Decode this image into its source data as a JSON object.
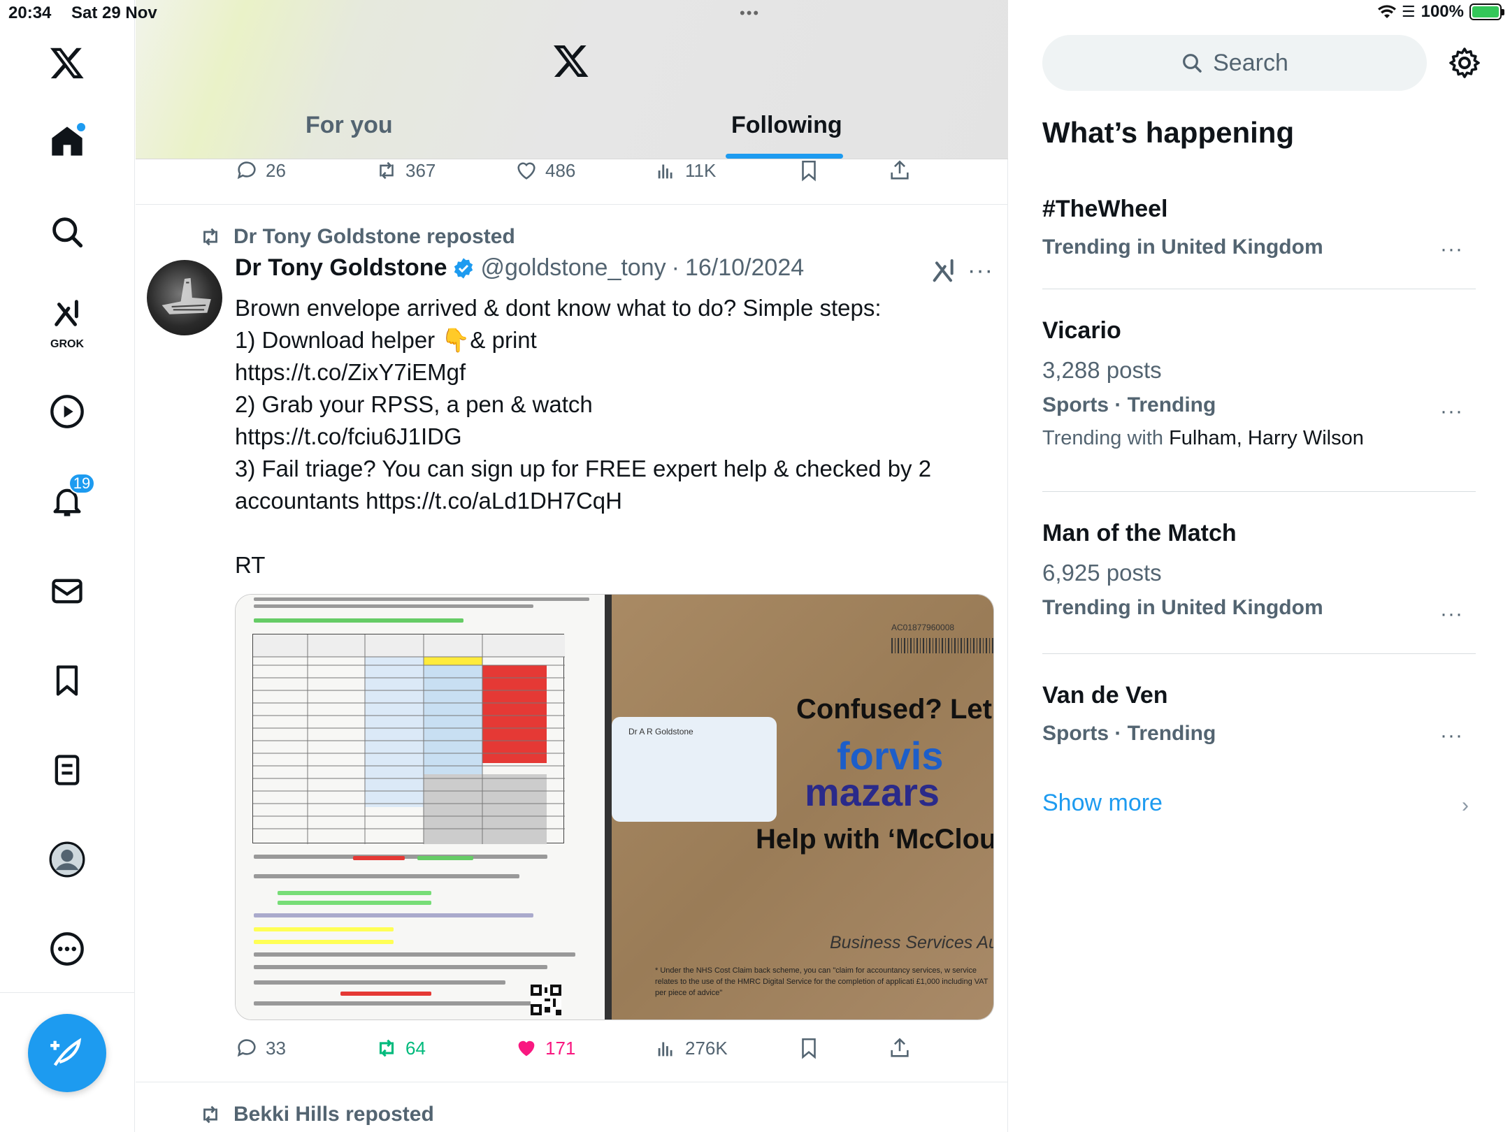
{
  "status_bar": {
    "time": "20:34",
    "date": "Sat 29 Nov",
    "battery": "100%",
    "battery_fill": 1.0
  },
  "nav": {
    "notifications_badge": "19",
    "grok_label": "GROK",
    "items": [
      "x-logo-icon",
      "home-icon",
      "search-icon",
      "grok-icon",
      "video-icon",
      "bell-icon",
      "mail-icon",
      "bookmark-icon",
      "lists-icon",
      "profile-icon",
      "more-icon"
    ]
  },
  "header": {
    "tabs": [
      {
        "label": "For you",
        "active": false
      },
      {
        "label": "Following",
        "active": true
      }
    ]
  },
  "prev_tweet_actions": {
    "replies": "26",
    "reposts": "367",
    "likes": "486",
    "views": "11K"
  },
  "tweet": {
    "reposted_by": "Dr Tony Goldstone reposted",
    "author_name": "Dr Tony Goldstone",
    "verified": true,
    "handle": "@goldstone_tony",
    "separator": "·",
    "date": "16/10/2024",
    "text": "Brown envelope arrived & dont know what to do? Simple steps:\n1) Download helper 👇& print\nhttps://t.co/ZixY7iEMgf\n2) Grab your RPSS, a pen & watch\nhttps://t.co/fciu6J1IDG\n3) Fail triage? You can sign up for FREE expert help & checked by 2 accountants https://t.co/aLd1DH7CqH\n\nRT",
    "media_right": {
      "account_code": "AC01877960008",
      "window_name": "Dr A R Goldstone",
      "line1": "Confused? Let",
      "brand1": "forvis",
      "brand2": "mazars",
      "line2": "Help with ‘McClou",
      "line3": "Business Services Auth",
      "fineprint": "* Under the NHS Cost Claim back scheme, you can \"claim for accountancy services, w service relates to the use of the HMRC Digital Service for the completion of applicati £1,000 including VAT per piece of advice\""
    },
    "actions": {
      "replies": "33",
      "reposts": "64",
      "likes": "171",
      "views": "276K"
    },
    "colors": {
      "repost": "#00ba7c",
      "like": "#f91880"
    }
  },
  "next_tweet": {
    "reposted_by": "Bekki Hills reposted"
  },
  "sidebar": {
    "search_placeholder": "Search",
    "section_title": "What’s happening",
    "trends": [
      {
        "name": "#TheWheel",
        "meta": "Trending in United Kingdom"
      },
      {
        "name": "Vicario",
        "posts": "3,288 posts",
        "meta": "Sports · Trending",
        "with_prefix": "Trending with",
        "with_names": "Fulham, Harry Wilson"
      },
      {
        "name": "Man of the Match",
        "posts": "6,925 posts",
        "meta": "Trending in United Kingdom"
      },
      {
        "name": "Van de Ven",
        "meta": "Sports · Trending"
      }
    ],
    "show_more": "Show more"
  },
  "accent_color": "#1d9bf0"
}
